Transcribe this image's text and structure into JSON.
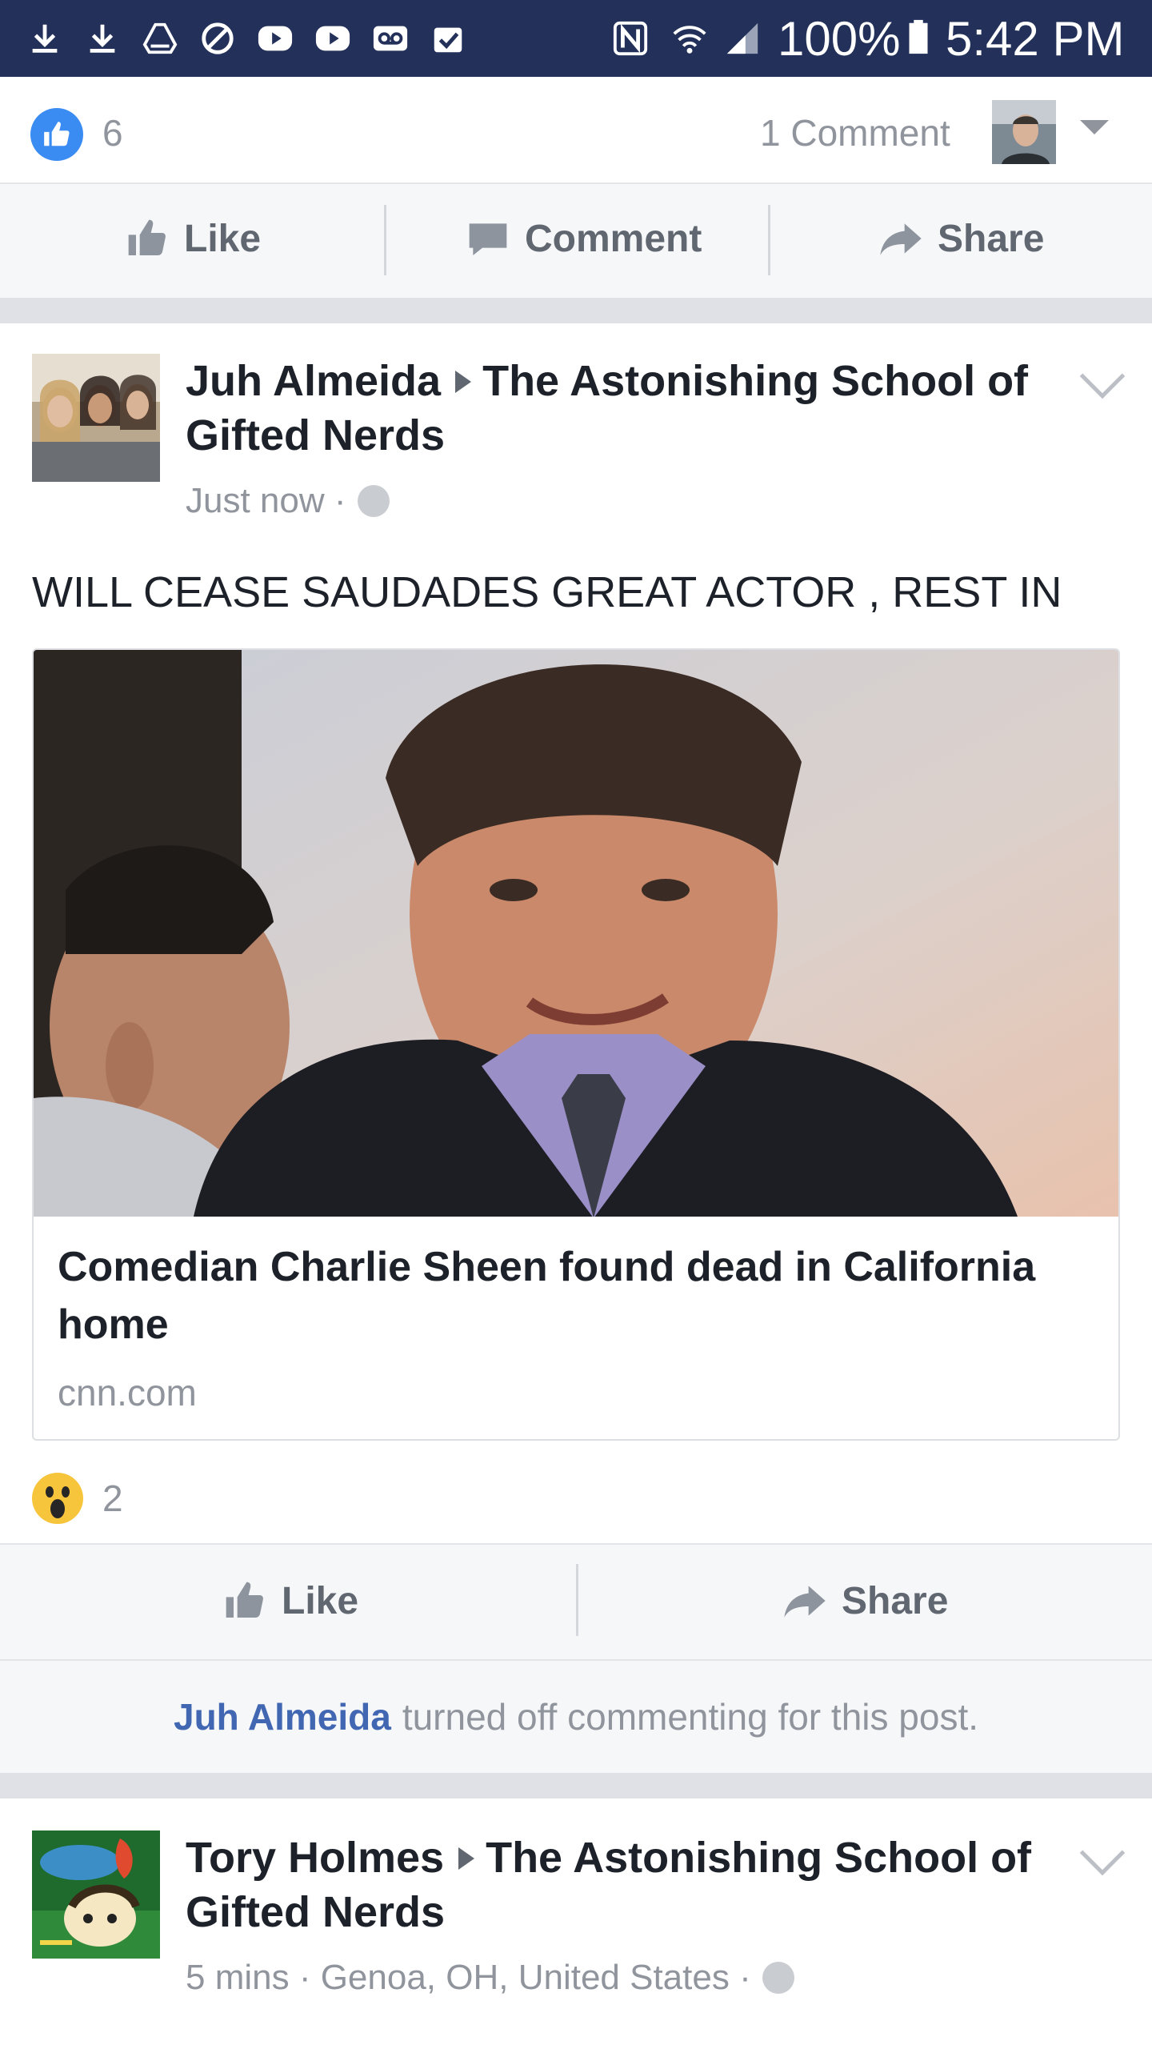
{
  "status_bar": {
    "icons": [
      "download-icon",
      "download-icon",
      "drive-icon",
      "blocked-icon",
      "youtube-icon",
      "youtube-icon",
      "voicemail-icon",
      "clipboard-check-icon",
      "nfc-icon",
      "wifi-icon",
      "signal-icon",
      "battery-icon"
    ],
    "battery": "100%",
    "time": "5:42 PM"
  },
  "summary": {
    "likes": "6",
    "comments": "1 Comment"
  },
  "action_bar_1": {
    "like": "Like",
    "comment": "Comment",
    "share": "Share"
  },
  "post1": {
    "author": "Juh Almeida",
    "group": "The Astonishing School of Gifted Nerds",
    "time": "Just now ·",
    "text": "WILL CEASE SAUDADES GREAT ACTOR , REST IN",
    "link": {
      "title": "Comedian Charlie Sheen found dead in California home",
      "domain": "cnn.com"
    },
    "reactions": "2",
    "actions": {
      "like": "Like",
      "share": "Share"
    },
    "notice_name": "Juh Almeida",
    "notice_text": "turned off commenting for this post."
  },
  "post2": {
    "author": "Tory Holmes",
    "group": "The Astonishing School of Gifted Nerds",
    "meta": "5 mins · Genoa, OH, United States ·"
  },
  "colors": {
    "status_bar": "#23315a",
    "facebook_blue": "#4267b2",
    "like_blue": "#3b8cf2",
    "wow_yellow": "#f7c53b"
  }
}
